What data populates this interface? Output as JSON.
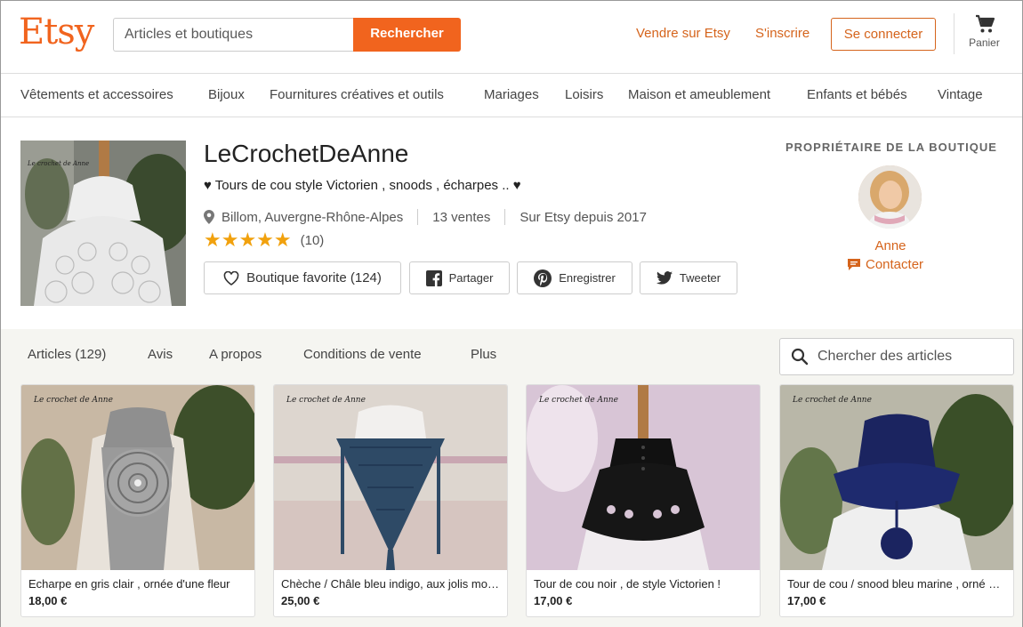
{
  "header": {
    "logo": "Etsy",
    "search_placeholder": "Articles et boutiques",
    "search_button": "Rechercher",
    "sell_link": "Vendre sur Etsy",
    "register_link": "S'inscrire",
    "login_button": "Se connecter",
    "cart_label": "Panier"
  },
  "categories": [
    "Vêtements et accessoires",
    "Bijoux",
    "Fournitures créatives et outils",
    "Mariages",
    "Loisirs",
    "Maison et ameublement",
    "Enfants et bébés",
    "Vintage"
  ],
  "shop": {
    "name": "LeCrochetDeAnne",
    "tagline": "♥ Tours de cou style Victorien , snoods , écharpes .. ♥",
    "location": "Billom, Auvergne-Rhône-Alpes",
    "sales": "13 ventes",
    "since": "Sur Etsy depuis 2017",
    "rating_stars": 5,
    "rating_count": "(10)",
    "favorite_button": "Boutique favorite (124)",
    "share_button": "Partager",
    "save_button": "Enregistrer",
    "tweet_button": "Tweeter",
    "image_watermark": "Le crochet de Anne"
  },
  "owner": {
    "title": "PROPRIÉTAIRE DE LA BOUTIQUE",
    "name": "Anne",
    "contact": "Contacter"
  },
  "tabs": [
    "Articles (129)",
    "Avis",
    "A propos",
    "Conditions de vente",
    "Plus"
  ],
  "items_search_placeholder": "Chercher des articles",
  "listings": [
    {
      "title": "Echarpe en gris clair , ornée d'une fleur",
      "price": "18,00 €",
      "watermark": "Le crochet de Anne"
    },
    {
      "title": "Chèche / Châle bleu indigo, aux jolis motifs",
      "price": "25,00 €",
      "watermark": "Le crochet de Anne"
    },
    {
      "title": "Tour de cou noir , de style Victorien !",
      "price": "17,00 €",
      "watermark": "Le crochet de Anne"
    },
    {
      "title": "Tour de cou / snood bleu marine , orné d'un pompon",
      "price": "17,00 €",
      "watermark": "Le crochet de Anne"
    }
  ],
  "colors": {
    "brand": "#f1641e",
    "link": "#d5641c",
    "star": "#f1a10d",
    "band": "#f5f5f1"
  }
}
